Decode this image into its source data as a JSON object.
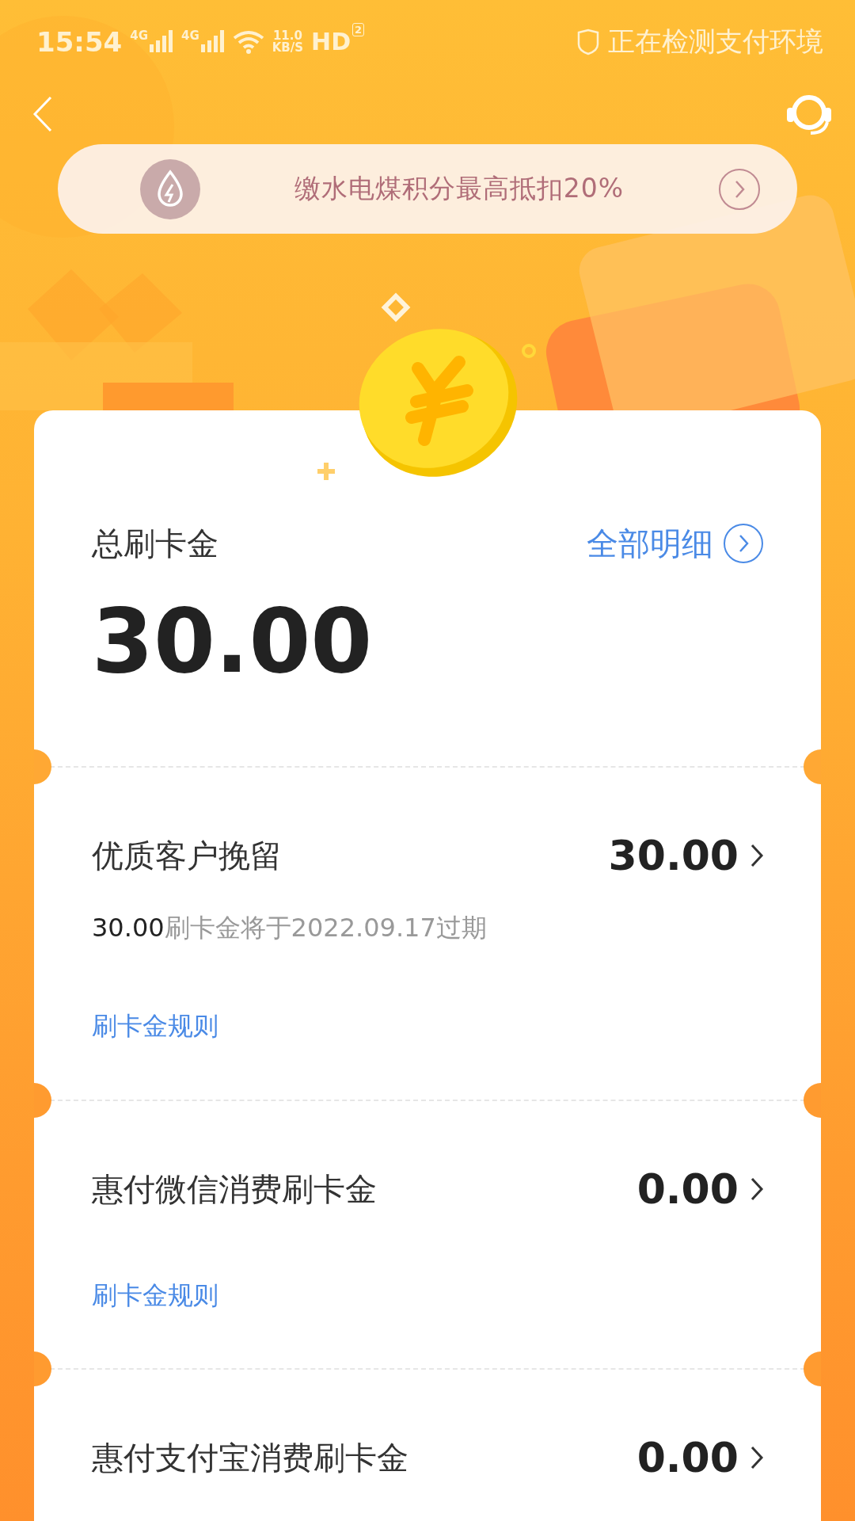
{
  "status_bar": {
    "time": "15:54",
    "signals": [
      "4G",
      "4G"
    ],
    "speed_value": "11.0",
    "speed_unit": "KB/S",
    "hd": "HD",
    "hd_index": "2",
    "security_text": "正在检测支付环境"
  },
  "banner": {
    "text": "缴水电煤积分最高抵扣20%"
  },
  "summary": {
    "title": "总刷卡金",
    "details_link": "全部明细",
    "amount": "30.00"
  },
  "rows": [
    {
      "title": "优质客户挽留",
      "amount": "30.00",
      "expiry": "**30.00**刷卡金将于2022.09.17过期",
      "rule_link": "刷卡金规则"
    },
    {
      "title": "惠付微信消费刷卡金",
      "amount": "0.00",
      "rule_link": "刷卡金规则"
    },
    {
      "title": "惠付支付宝消费刷卡金",
      "amount": "0.00"
    }
  ]
}
